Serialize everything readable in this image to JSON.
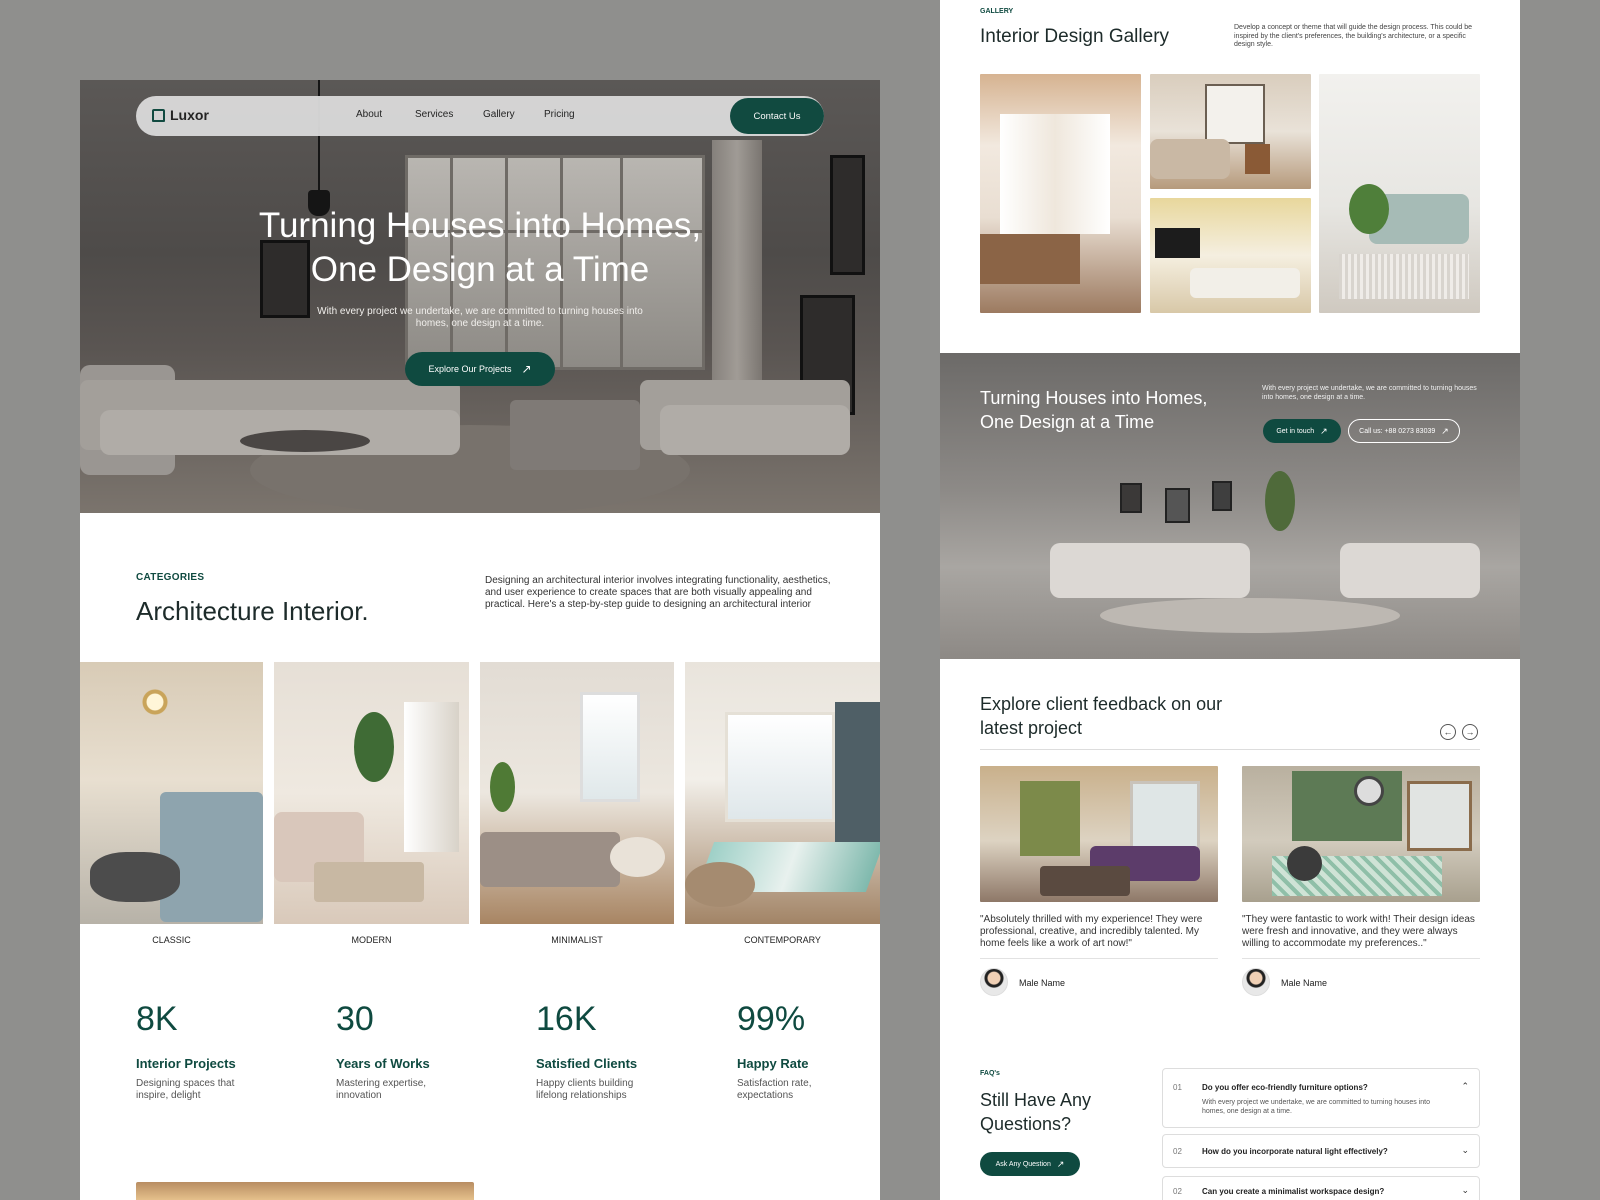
{
  "landing": {
    "brand": "Luxor",
    "nav": [
      "About",
      "Services",
      "Gallery",
      "Pricing"
    ],
    "contact_button": "Contact Us",
    "hero_title_line1": "Turning Houses into Homes,",
    "hero_title_line2": "One Design at a Time",
    "hero_subtitle": "With every project we undertake, we are committed to turning houses into homes, one design at a time.",
    "explore_button": "Explore Our Projects",
    "categories_tag": "CATEGORIES",
    "categories_title": "Architecture Interior.",
    "categories_desc": "Designing an architectural interior involves integrating functionality, aesthetics, and user experience to create spaces that are both visually appealing and practical. Here's a step-by-step guide to designing an architectural interior",
    "rooms": [
      "CLASSIC",
      "MODERN",
      "MINIMALIST",
      "CONTEMPORARY"
    ],
    "stats": [
      {
        "value": "8K",
        "title": "Interior Projects",
        "desc": "Designing spaces that inspire, delight"
      },
      {
        "value": "30",
        "title": "Years of Works",
        "desc": "Mastering expertise, innovation"
      },
      {
        "value": "16K",
        "title": "Satisfied Clients",
        "desc": "Happy clients building lifelong relationships"
      },
      {
        "value": "99%",
        "title": "Happy Rate",
        "desc": "Satisfaction rate, expectations"
      }
    ]
  },
  "gallery": {
    "tag": "GALLERY",
    "title": "Interior Design Gallery",
    "desc": "Develop a concept or theme that will guide the design process. This could be inspired by the client's preferences, the building's architecture, or a specific design style."
  },
  "cta": {
    "title": "Turning Houses into Homes, One Design at a Time",
    "desc": "With every project we undertake, we are committed to turning houses into homes, one design at a time.",
    "get_in_touch": "Get in touch",
    "call": "Call us: +88 0273 83039"
  },
  "feedback": {
    "title_line1": "Explore client feedback on our",
    "title_line2": "latest project",
    "items": [
      {
        "quote": "\"Absolutely thrilled with my experience! They were professional, creative, and incredibly talented. My home feels like a work of art now!\"",
        "name": "Male Name"
      },
      {
        "quote": "\"They were fantastic to work with! Their design ideas were fresh and innovative, and they were always willing to accommodate my preferences..\"",
        "name": "Male Name"
      }
    ]
  },
  "faq": {
    "tag": "FAQ's",
    "title": "Still Have Any Questions?",
    "ask_button": "Ask Any Question",
    "items": [
      {
        "num": "01",
        "question": "Do you offer eco-friendly furniture options?",
        "answer": "With every project we undertake, we are committed to turning houses into homes, one design at a time."
      },
      {
        "num": "02",
        "question": "How do you incorporate natural light effectively?"
      },
      {
        "num": "02",
        "question": "Can you create a minimalist workspace design?"
      }
    ]
  },
  "colors": {
    "accent": "#0f4a40",
    "background": "#8f8f8d"
  }
}
